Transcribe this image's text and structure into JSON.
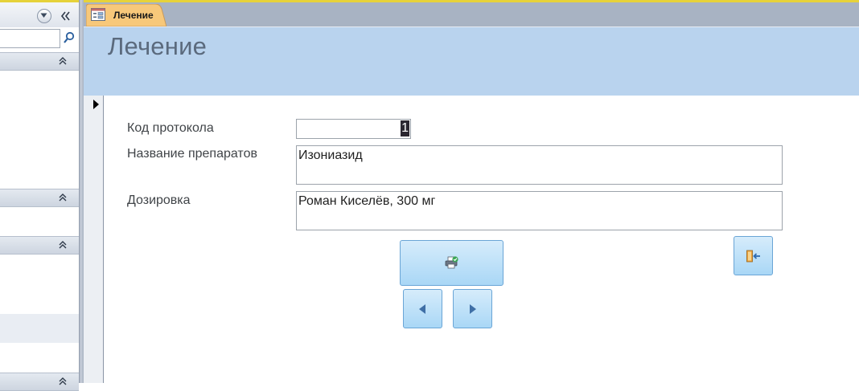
{
  "window": {
    "tab_title": "Лечение"
  },
  "form": {
    "title": "Лечение",
    "fields": {
      "protocol_code": {
        "label": "Код протокола",
        "value": "1"
      },
      "drug_names": {
        "label": "Название препаратов",
        "value": "Изониазид"
      },
      "dosage": {
        "label": "Дозировка",
        "value": "Роман Киселёв, 300 мг"
      }
    }
  },
  "icons": {
    "tab_icon": "form-icon",
    "print": "print-icon",
    "prev": "arrow-left-icon",
    "next": "arrow-right-icon",
    "exit": "exit-icon",
    "search": "search-icon"
  },
  "colors": {
    "header_band": "#b9d3ee",
    "title_text": "#5b6a7d",
    "button_face": "#a9d7f6",
    "tab_active": "#f7c87a"
  }
}
